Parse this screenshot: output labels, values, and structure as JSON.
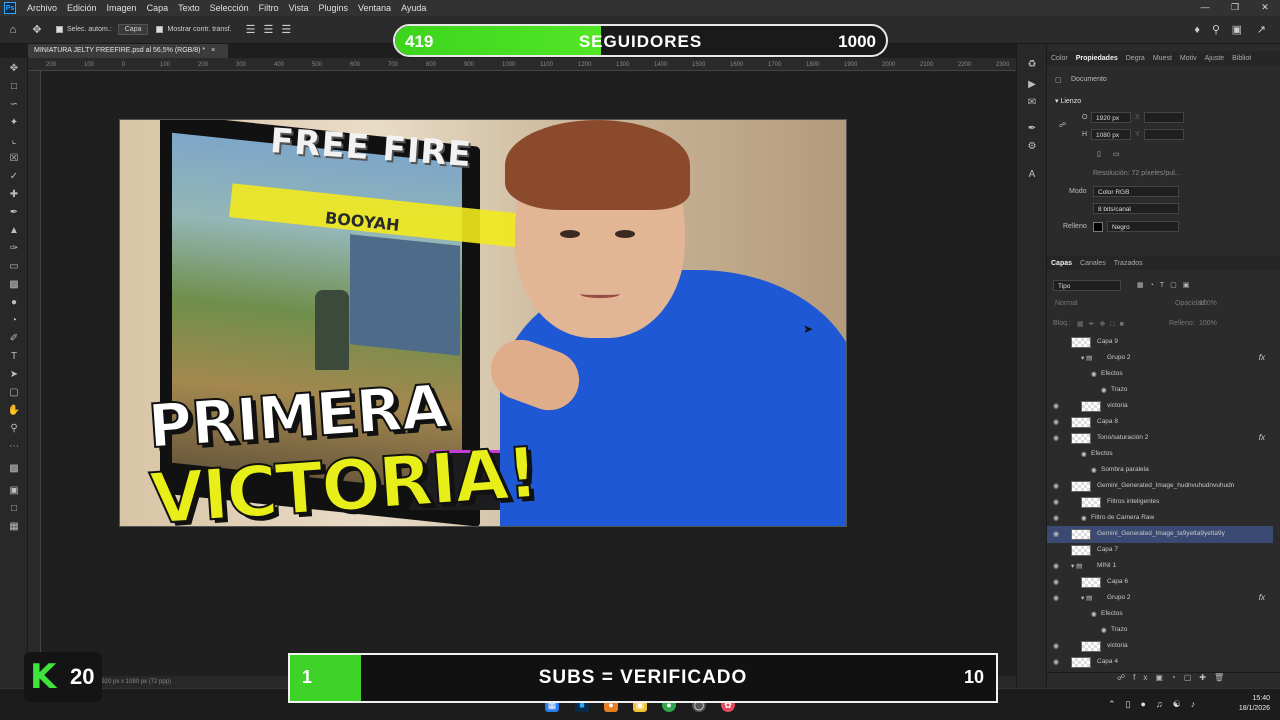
{
  "menubar": {
    "items": [
      "Archivo",
      "Edición",
      "Imagen",
      "Capa",
      "Texto",
      "Selección",
      "Filtro",
      "Vista",
      "Plugins",
      "Ventana",
      "Ayuda"
    ],
    "logo": "Ps"
  },
  "options": {
    "auto_select_label": "Selec. autom.:",
    "auto_select_value": "Capa",
    "show_transform_label": "Mostrar contr. transf."
  },
  "document_tab": "MINIATURA JELTY FREEFIRE.psd al 56,5% (RGB/8) *",
  "ruler_ticks": [
    "200",
    "100",
    "0",
    "100",
    "200",
    "300",
    "400",
    "500",
    "600",
    "700",
    "800",
    "900",
    "1000",
    "1100",
    "1200",
    "1300",
    "1400",
    "1500",
    "1600",
    "1700",
    "1800",
    "1900",
    "2000",
    "2100",
    "2200",
    "2300"
  ],
  "thumbnail": {
    "logo": "FREE FIRE",
    "banner": "BOOYAH",
    "line1": "PRIMERA",
    "line2": "VICTORIA!"
  },
  "followers_bar": {
    "current": "419",
    "label": "SEGUIDORES",
    "max": "1000",
    "progress": 0.419,
    "fill_color": "#52e626"
  },
  "properties": {
    "tabs": [
      "Color",
      "Propiedades",
      "Degra",
      "Muest",
      "Motiv",
      "Ajuste",
      "Bibliot"
    ],
    "active_tab": "Propiedades",
    "doc_label": "Documento",
    "section": "Lienzo",
    "width_label": "O",
    "width": "1920 px",
    "height_label": "H",
    "height": "1080 px",
    "x_label": "X",
    "y_label": "Y",
    "resolution": "Resolución: 72 píxeles/pul...",
    "mode_label": "Modo",
    "mode": "Color RGB",
    "depth": "8 bits/canal",
    "fill_label": "Relleno",
    "fill": "Negro"
  },
  "layers_panel": {
    "tabs": [
      "Capas",
      "Canales",
      "Trazados"
    ],
    "filter": "Tipo",
    "blend": "Normal",
    "opacity_label": "Opacidad:",
    "opacity": "100%",
    "lock_label": "Bloq.:",
    "fill_label": "Relleno:",
    "fill": "100%",
    "layers": [
      {
        "name": "Capa 9",
        "indent": 0,
        "fx": false,
        "eye": false,
        "thumb": true
      },
      {
        "name": "Grupo 2",
        "indent": 1,
        "fx": true,
        "eye": false,
        "thumb": false,
        "folder": true
      },
      {
        "name": "Efectos",
        "indent": 2,
        "fx": false,
        "eye": false,
        "thumb": false
      },
      {
        "name": "Trazo",
        "indent": 3,
        "fx": false,
        "eye": false,
        "thumb": false
      },
      {
        "name": "victoria",
        "indent": 1,
        "fx": false,
        "eye": true,
        "thumb": true
      },
      {
        "name": "Capa 8",
        "indent": 0,
        "fx": false,
        "eye": true,
        "thumb": true
      },
      {
        "name": "Tono/saturación 2",
        "indent": 0,
        "fx": true,
        "eye": true,
        "thumb": true
      },
      {
        "name": "Efectos",
        "indent": 1,
        "fx": false,
        "eye": false,
        "thumb": false
      },
      {
        "name": "Sombra paralela",
        "indent": 2,
        "fx": false,
        "eye": false,
        "thumb": false
      },
      {
        "name": "Gemini_Generated_Image_hudnvuhudnvuhudn",
        "indent": 0,
        "fx": false,
        "eye": true,
        "thumb": true
      },
      {
        "name": "Filtros inteligentes",
        "indent": 1,
        "fx": false,
        "eye": true,
        "thumb": true
      },
      {
        "name": "Filtro de Camera Raw",
        "indent": 1,
        "fx": false,
        "eye": true,
        "thumb": false
      },
      {
        "name": "Gemini_Generated_Image_ta9yetta9yetta9y",
        "indent": 0,
        "fx": false,
        "eye": true,
        "thumb": true,
        "selected": true
      },
      {
        "name": "Capa 7",
        "indent": 0,
        "fx": false,
        "eye": false,
        "thumb": true
      },
      {
        "name": "MINI 1",
        "indent": 0,
        "fx": false,
        "eye": true,
        "thumb": false,
        "folder": true
      },
      {
        "name": "Capa 6",
        "indent": 1,
        "fx": false,
        "eye": true,
        "thumb": true
      },
      {
        "name": "Grupo 2",
        "indent": 1,
        "fx": true,
        "eye": true,
        "thumb": false,
        "folder": true
      },
      {
        "name": "Efectos",
        "indent": 2,
        "fx": false,
        "eye": false,
        "thumb": false
      },
      {
        "name": "Trazo",
        "indent": 3,
        "fx": false,
        "eye": false,
        "thumb": false
      },
      {
        "name": "victoria",
        "indent": 1,
        "fx": false,
        "eye": true,
        "thumb": true
      },
      {
        "name": "Capa 4",
        "indent": 0,
        "fx": false,
        "eye": true,
        "thumb": true
      }
    ]
  },
  "statusbar": "1920 px x 1080 px (72 ppp)",
  "subs_bar": {
    "current": "1",
    "label": "SUBS = VERIFICADO",
    "max": "10",
    "progress": 0.1,
    "fill_color": "#3fd32a"
  },
  "badge": {
    "letter": "K",
    "number": "20"
  },
  "clock": {
    "time": "15:40",
    "date": "18/1/2026"
  }
}
